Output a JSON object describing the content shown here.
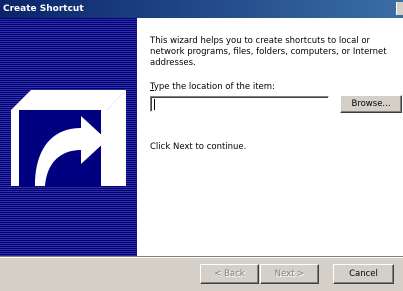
{
  "window": {
    "title": "Create Shortcut"
  },
  "sidebar": {
    "art_icon": "shortcut-arrow-icon",
    "colors": {
      "background": "#000080",
      "tile": "#ffffff",
      "shadow": "#000000"
    }
  },
  "content": {
    "description": "This wizard helps you to create shortcuts to local or network programs, files, folders, computers, or Internet addresses.",
    "location_label_accel": "T",
    "location_label_rest": "ype the location of the item:",
    "location_value": "",
    "browse_label": "Browse...",
    "continue_note": "Click Next to continue."
  },
  "buttons": {
    "back": "< Back",
    "next": "Next >",
    "cancel": "Cancel"
  }
}
